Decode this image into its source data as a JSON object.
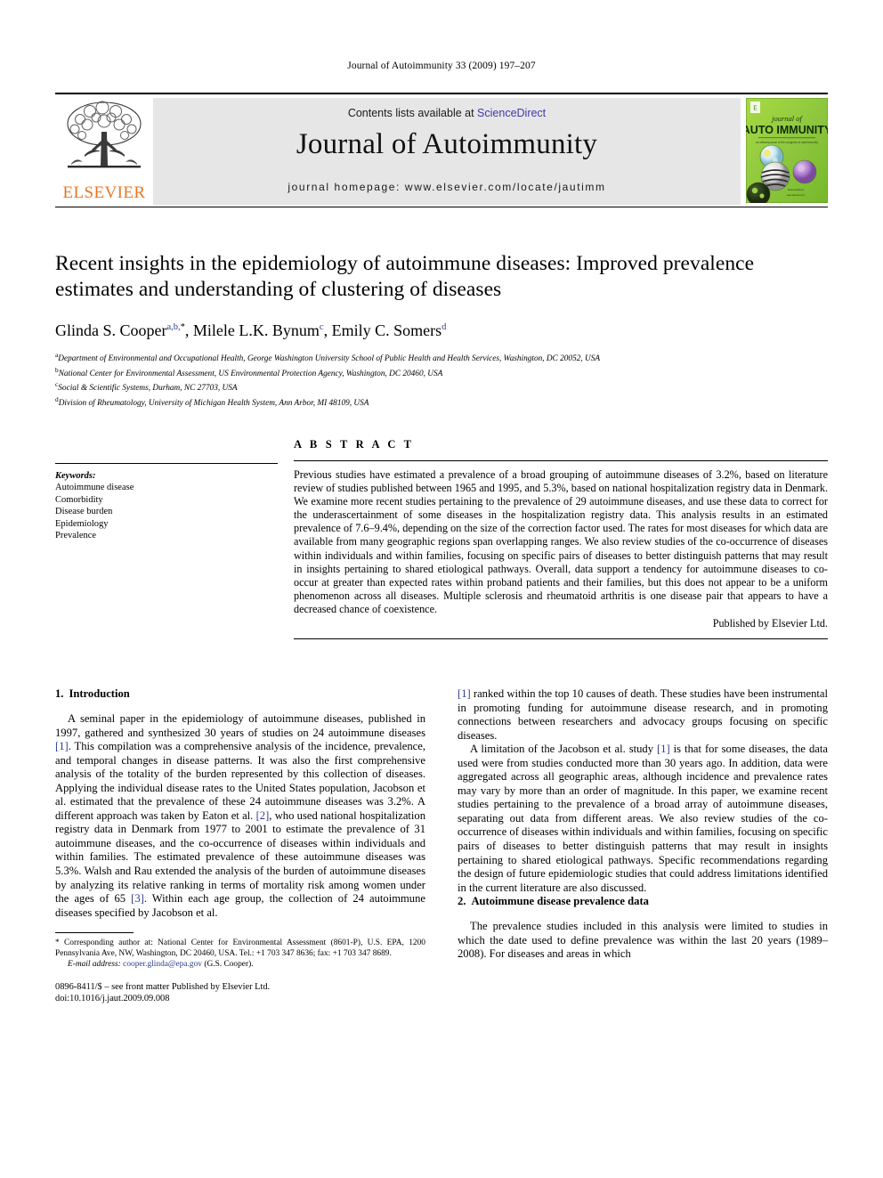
{
  "running_head": "Journal of Autoimmunity 33 (2009) 197–207",
  "masthead": {
    "contents_prefix": "Contents lists available at ",
    "sciencedirect": "ScienceDirect",
    "journal_name": "Journal of Autoimmunity",
    "homepage": "journal homepage: www.elsevier.com/locate/jautimm",
    "publisher_logo_text": "ELSEVIER",
    "cover": {
      "line1": "journal of",
      "line2": "AUTO IMMUNITY",
      "tagline": "an official journal of the international congress of autoimmunity"
    },
    "link_color": "#3a3ab0",
    "band_color": "#e6e6e6",
    "elsevier_orange": "#e87722",
    "cover_green": "#8dc63f"
  },
  "article": {
    "title": "Recent insights in the epidemiology of autoimmune diseases: Improved prevalence estimates and understanding of clustering of diseases",
    "authors": [
      {
        "name": "Glinda S. Cooper",
        "marks": "a,b,",
        "star": "*"
      },
      {
        "name": "Milele L.K. Bynum",
        "marks": "c"
      },
      {
        "name": "Emily C. Somers",
        "marks": "d"
      }
    ],
    "affiliations": [
      {
        "mark": "a",
        "text": "Department of Environmental and Occupational Health, George Washington University School of Public Health and Health Services, Washington, DC 20052, USA"
      },
      {
        "mark": "b",
        "text": "National Center for Environmental Assessment, US Environmental Protection Agency, Washington, DC 20460, USA"
      },
      {
        "mark": "c",
        "text": "Social & Scientific Systems, Durham, NC 27703, USA"
      },
      {
        "mark": "d",
        "text": "Division of Rheumatology, University of Michigan Health System, Ann Arbor, MI 48109, USA"
      }
    ]
  },
  "keywords": {
    "heading": "Keywords:",
    "items": [
      "Autoimmune disease",
      "Comorbidity",
      "Disease burden",
      "Epidemiology",
      "Prevalence"
    ]
  },
  "abstract": {
    "heading": "A B S T R A C T",
    "text": "Previous studies have estimated a prevalence of a broad grouping of autoimmune diseases of 3.2%, based on literature review of studies published between 1965 and 1995, and 5.3%, based on national hospitalization registry data in Denmark. We examine more recent studies pertaining to the prevalence of 29 autoimmune diseases, and use these data to correct for the underascertainment of some diseases in the hospitalization registry data. This analysis results in an estimated prevalence of 7.6–9.4%, depending on the size of the correction factor used. The rates for most diseases for which data are available from many geographic regions span overlapping ranges. We also review studies of the co-occurrence of diseases within individuals and within families, focusing on specific pairs of diseases to better distinguish patterns that may result in insights pertaining to shared etiological pathways. Overall, data support a tendency for autoimmune diseases to co-occur at greater than expected rates within proband patients and their families, but this does not appear to be a uniform phenomenon across all diseases. Multiple sclerosis and rheumatoid arthritis is one disease pair that appears to have a decreased chance of coexistence.",
    "published_by": "Published by Elsevier Ltd."
  },
  "body": {
    "section1": {
      "number": "1.",
      "title": "Introduction",
      "para1_a": "A seminal paper in the epidemiology of autoimmune diseases, published in 1997, gathered and synthesized 30 years of studies on 24 autoimmune diseases ",
      "para1_cite1": "[1]",
      "para1_b": ". This compilation was a comprehensive analysis of the incidence, prevalence, and temporal changes in disease patterns. It was also the first comprehensive analysis of the totality of the burden represented by this collection of diseases. Applying the individual disease rates to the United States population, Jacobson et al. estimated that the prevalence of these 24 autoimmune diseases was 3.2%. A different approach was taken by Eaton et al. ",
      "para1_cite2": "[2]",
      "para1_c": ", who used national hospitalization registry data in Denmark from 1977 to 2001 to estimate the prevalence of 31 autoimmune diseases, and the co-occurrence of diseases within individuals and within families. The estimated prevalence of these autoimmune diseases was 5.3%. Walsh and Rau extended the analysis of the burden of autoimmune diseases by analyzing its relative ranking in terms of mortality risk among women under the ages of 65 ",
      "para1_cite3": "[3]",
      "para1_d": ". Within each age group, the collection of 24 autoimmune diseases specified by Jacobson et al. ",
      "para1_cite4": "[1]",
      "para1_e": " ranked within the top 10 causes of death. These studies have been instrumental in promoting funding for autoimmune disease research, and in promoting connections between researchers and advocacy groups focusing on specific diseases.",
      "para2_a": "A limitation of the Jacobson et al. study ",
      "para2_cite1": "[1]",
      "para2_b": " is that for some diseases, the data used were from studies conducted more than 30 years ago. In addition, data were aggregated across all geographic areas, although incidence and prevalence rates may vary by more than an order of magnitude. In this paper, we examine recent studies pertaining to the prevalence of a broad array of autoimmune diseases, separating out data from different areas. We also review studies of the co-occurrence of diseases within individuals and within families, focusing on specific pairs of diseases to better distinguish patterns that may result in insights pertaining to shared etiological pathways. Specific recommendations regarding the design of future epidemiologic studies that could address limitations identified in the current literature are also discussed."
    },
    "section2": {
      "number": "2.",
      "title": "Autoimmune disease prevalence data",
      "para1": "The prevalence studies included in this analysis were limited to studies in which the date used to define prevalence was within the last 20 years (1989–2008). For diseases and areas in which"
    }
  },
  "footnote": {
    "star": "*",
    "corresponding_a": " Corresponding author at: National Center for Environmental Assessment (8601-P), U.S. EPA, 1200 Pennsylvania Ave, NW, Washington, DC 20460, USA. Tel.: +1 703 347 8636; fax: +1 703 347 8689.",
    "email_label": "E-mail address:",
    "email": "cooper.glinda@epa.gov",
    "email_suffix": " (G.S. Cooper)."
  },
  "imprint": {
    "issn_line": "0896-8411/$ – see front matter Published by Elsevier Ltd.",
    "doi_line": "doi:10.1016/j.jaut.2009.09.008"
  }
}
